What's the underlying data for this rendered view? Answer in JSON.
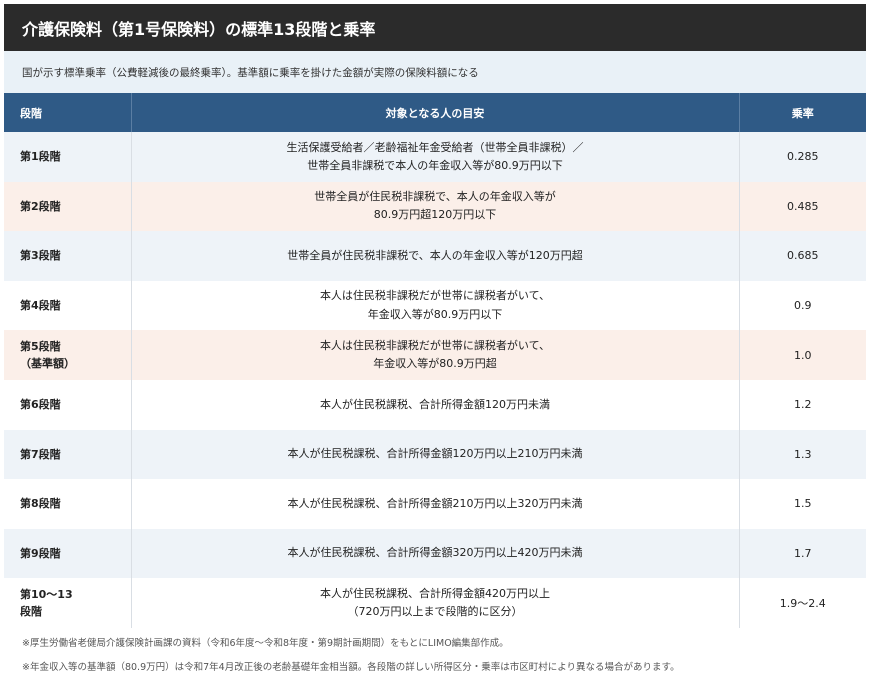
{
  "title": "介護保険料（第1号保険料）の標準13段階と乗率",
  "subtitle": "国が示す標準乗率（公費軽減後の最終乗率）。基準額に乗率を掛けた金額が実際の保険料額になる",
  "header": {
    "level": "段階",
    "target": "対象となる人の目安",
    "rate": "乗率"
  },
  "rows": [
    {
      "level": [
        "第1段階"
      ],
      "desc": [
        "生活保護受給者／老齢福祉年金受給者（世帯全員非課税）／",
        "世帯全員非課税で本人の年金収入等が80.9万円以下"
      ],
      "rate": "0.285"
    },
    {
      "level": [
        "第2段階"
      ],
      "desc": [
        "世帯全員が住民税非課税で、本人の年金収入等が",
        "80.9万円超120万円以下"
      ],
      "rate": "0.485"
    },
    {
      "level": [
        "第3段階"
      ],
      "desc": [
        "世帯全員が住民税非課税で、本人の年金収入等が120万円超"
      ],
      "rate": "0.685"
    },
    {
      "level": [
        "第4段階"
      ],
      "desc": [
        "本人は住民税非課税だが世帯に課税者がいて、",
        "年金収入等が80.9万円以下"
      ],
      "rate": "0.9"
    },
    {
      "level": [
        "第5段階",
        "（基準額）"
      ],
      "desc": [
        "本人は住民税非課税だが世帯に課税者がいて、",
        "年金収入等が80.9万円超"
      ],
      "rate": "1.0"
    },
    {
      "level": [
        "第6段階"
      ],
      "desc": [
        "本人が住民税課税、合計所得金額120万円未満"
      ],
      "rate": "1.2"
    },
    {
      "level": [
        "第7段階"
      ],
      "desc": [
        "本人が住民税課税、合計所得金額120万円以上210万円未満"
      ],
      "rate": "1.3"
    },
    {
      "level": [
        "第8段階"
      ],
      "desc": [
        "本人が住民税課税、合計所得金額210万円以上320万円未満"
      ],
      "rate": "1.5"
    },
    {
      "level": [
        "第9段階"
      ],
      "desc": [
        "本人が住民税課税、合計所得金額320万円以上420万円未満"
      ],
      "rate": "1.7"
    },
    {
      "level": [
        "第10～13",
        "段階"
      ],
      "desc": [
        "本人が住民税課税、合計所得金額420万円以上",
        "（720万円以上まで段階的に区分）"
      ],
      "rate": "1.9～2.4"
    }
  ],
  "row_colors": [
    "blue",
    "pink",
    "blue",
    "white",
    "pink",
    "white",
    "blue",
    "white",
    "blue",
    "white"
  ],
  "colors": {
    "title_bg": "#2b2b2b",
    "subtitle_bg": "#e9f1f7",
    "header_bg": "#2f5a86",
    "row_blue": "#eef3f8",
    "row_pink": "#fbefe9",
    "row_white": "#ffffff"
  },
  "notes": [
    "※厚生労働省老健局介護保険計画課の資料（令和6年度～令和8年度・第9期計画期間）をもとにLIMO編集部作成。",
    "※年金収入等の基準額（80.9万円）は令和7年4月改正後の老齢基礎年金相当額。各段階の詳しい所得区分・乗率は市区町村により異なる場合があります。"
  ]
}
